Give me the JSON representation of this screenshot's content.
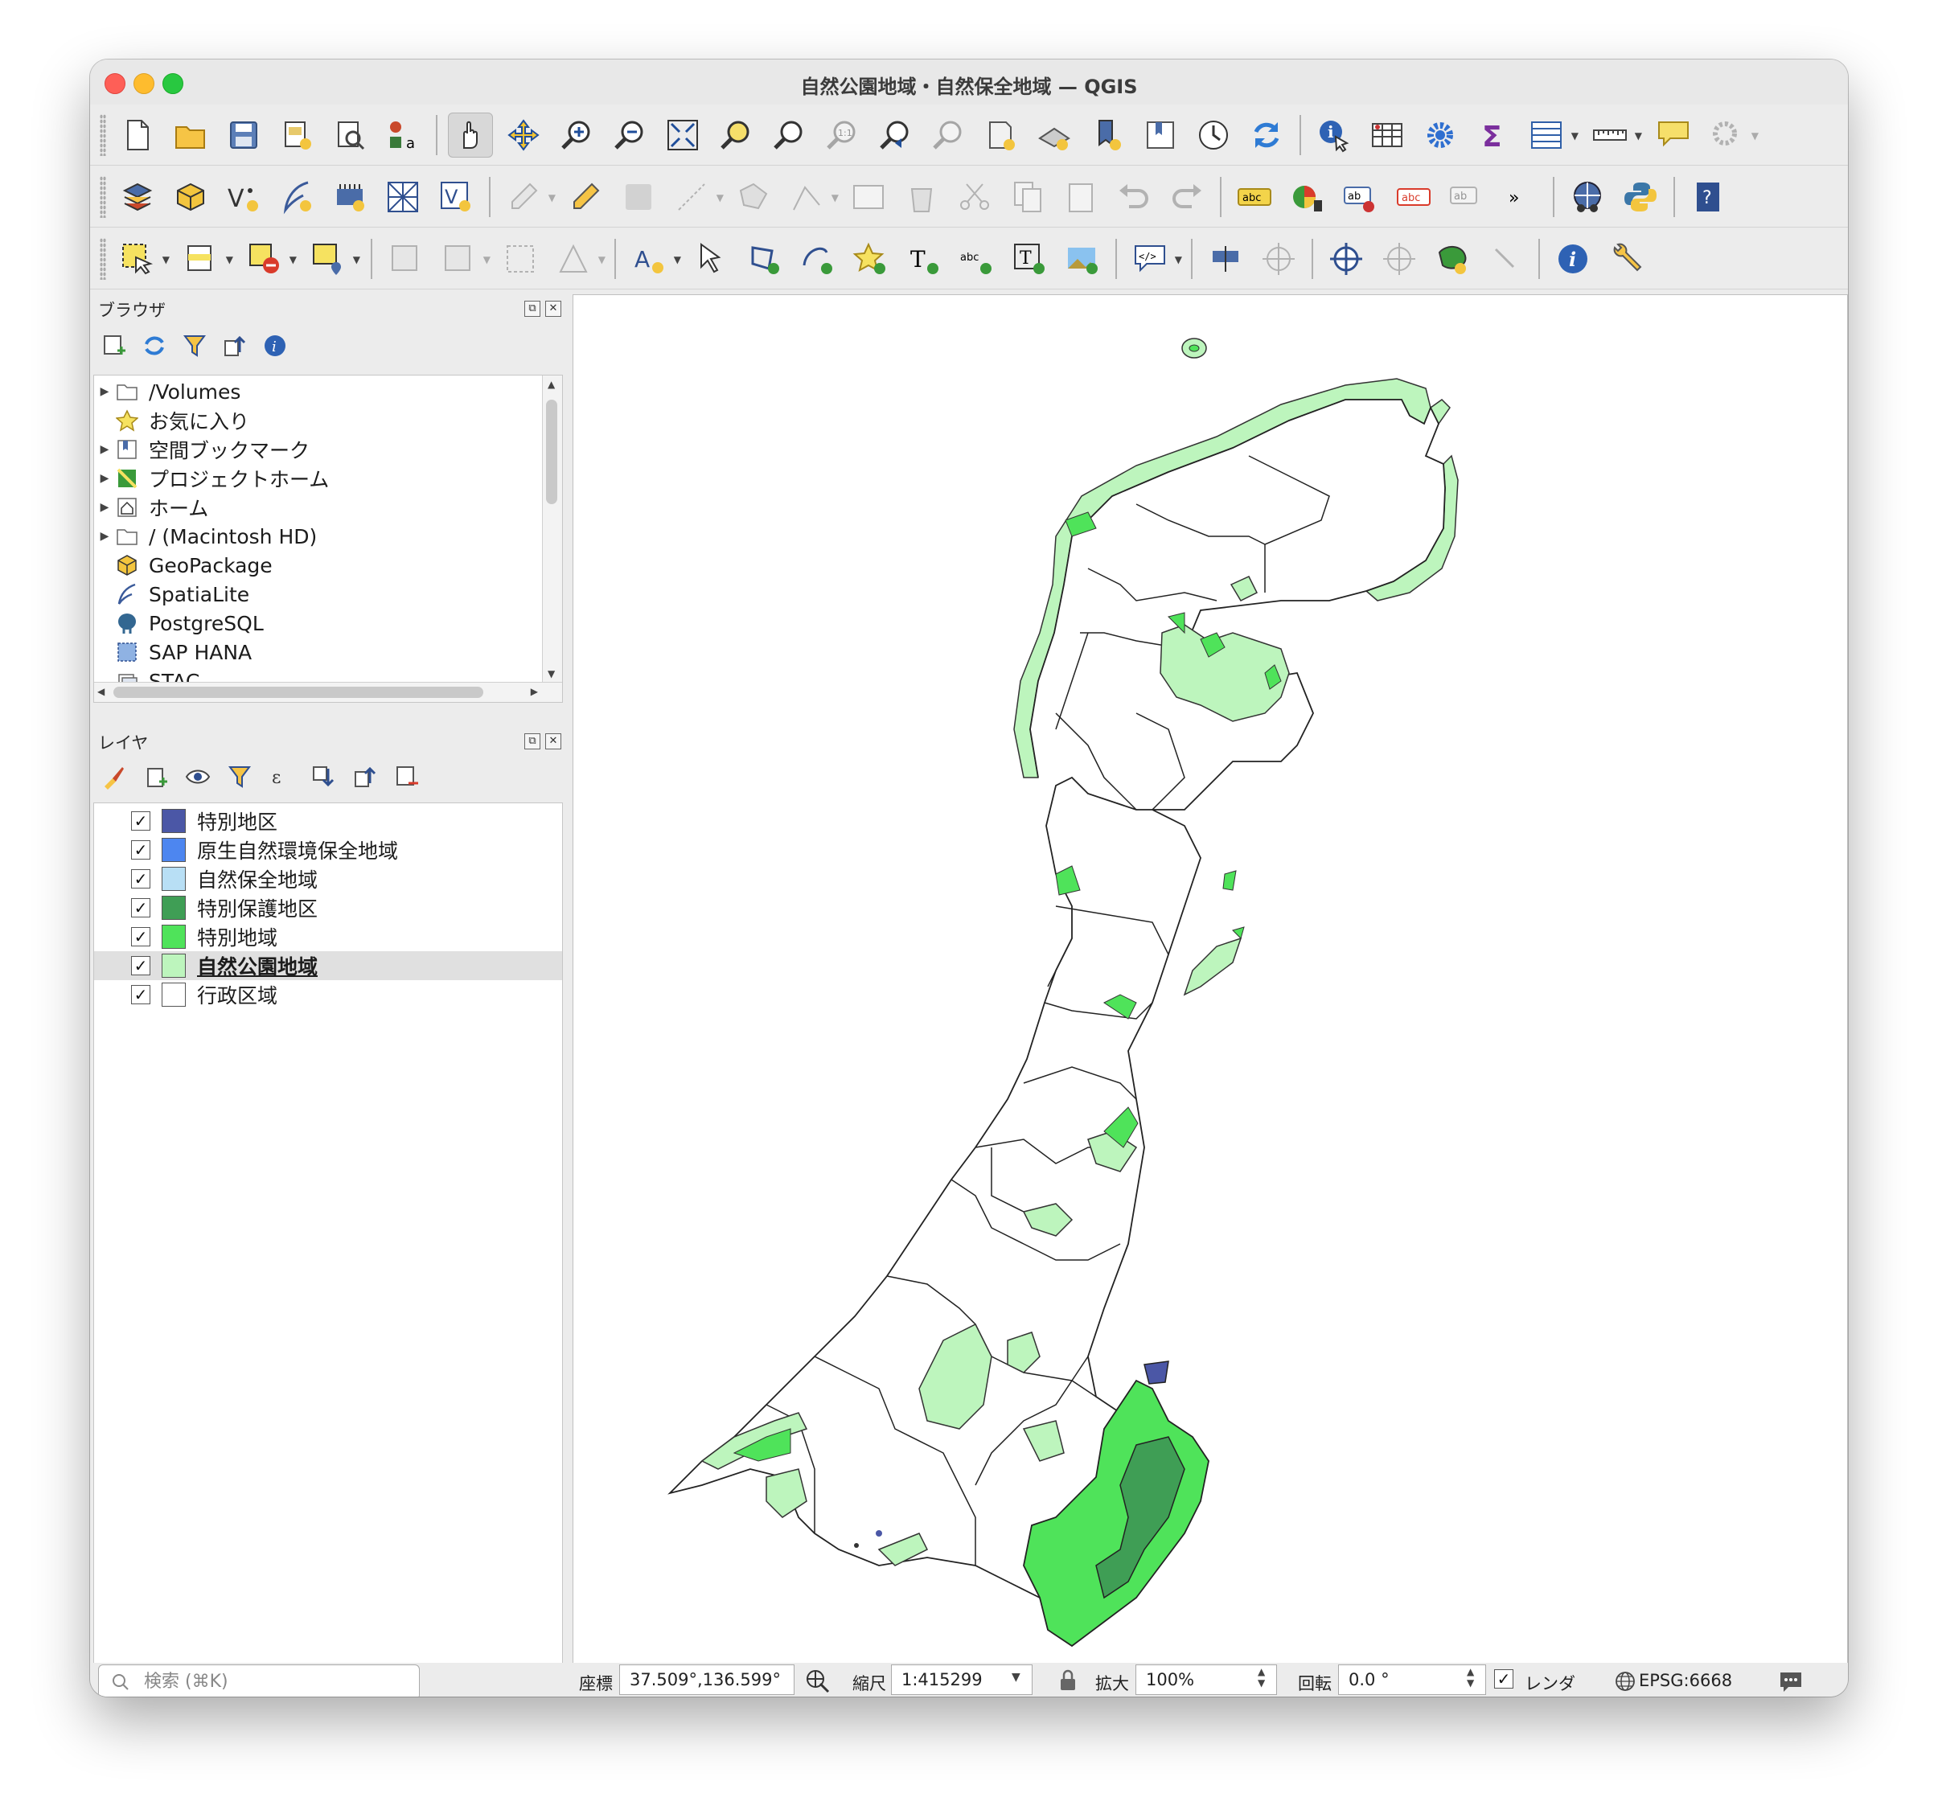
{
  "window": {
    "title": "自然公園地域・自然保全地域 — QGIS"
  },
  "toolbars": {
    "row1": [
      "new-project",
      "open-project",
      "save-project",
      "print-layout",
      "layout-manager",
      "style-manager",
      "pan-map",
      "pan-to-selection",
      "zoom-in",
      "zoom-out",
      "zoom-full",
      "zoom-to-selection",
      "zoom-to-layer",
      "zoom-native",
      "zoom-last",
      "zoom-next",
      "new-map-view",
      "new-3d-view",
      "new-bookmark",
      "show-bookmarks",
      "temporal-controller",
      "refresh",
      "identify",
      "attribute-table-open",
      "settings",
      "statistics",
      "attribute-table",
      "measure",
      "map-tips",
      "locator"
    ],
    "row2": [
      "data-source-manager",
      "new-geopackage",
      "new-shapefile",
      "new-spatialite",
      "new-virtual",
      "new-mesh",
      "new-temp-scratch",
      "toggle-editing",
      "digitize",
      "save-edits",
      "add-line",
      "add-polygon",
      "vertex-tool",
      "edit-attributes",
      "delete",
      "cut",
      "copy",
      "paste",
      "undo",
      "redo",
      "label-tool",
      "diagram-tool",
      "highlight-label",
      "label-properties",
      "pin-labels",
      "more",
      "globe",
      "python",
      "help"
    ],
    "row3": [
      "select-feature",
      "select-by-attribute",
      "deselect",
      "select-by-location",
      "digitize-shape",
      "advanced-digitize",
      "split",
      "reshape",
      "label-tool-2",
      "select-annotation",
      "add-polygon-annotation",
      "add-line-annotation",
      "add-point-annotation",
      "add-text-annotation",
      "add-point-text",
      "add-rect-text",
      "add-picture-annotation",
      "html-annotation",
      "georef",
      "coordinate",
      "crosshair",
      "geometry-checker",
      "rename",
      "info",
      "wrench"
    ]
  },
  "browser": {
    "title": "ブラウザ",
    "items": [
      {
        "label": "/Volumes",
        "icon": "folder-icon",
        "expandable": true
      },
      {
        "label": "お気に入り",
        "icon": "star-icon",
        "expandable": false
      },
      {
        "label": "空間ブックマーク",
        "icon": "bookmark-icon",
        "expandable": true
      },
      {
        "label": "プロジェクトホーム",
        "icon": "project-home-icon",
        "expandable": true
      },
      {
        "label": "ホーム",
        "icon": "home-icon",
        "expandable": true
      },
      {
        "label": "/ (Macintosh HD)",
        "icon": "folder-icon",
        "expandable": true
      },
      {
        "label": "GeoPackage",
        "icon": "geopackage-icon",
        "expandable": false
      },
      {
        "label": "SpatiaLite",
        "icon": "spatialite-icon",
        "expandable": false
      },
      {
        "label": "PostgreSQL",
        "icon": "postgresql-icon",
        "expandable": false
      },
      {
        "label": "SAP HANA",
        "icon": "sap-hana-icon",
        "expandable": false
      },
      {
        "label": "STAC",
        "icon": "stac-icon",
        "expandable": false
      }
    ]
  },
  "layers": {
    "title": "レイヤ",
    "items": [
      {
        "label": "特別地区",
        "color": "#4b57a6",
        "checked": "✓"
      },
      {
        "label": "原生自然環境保全地域",
        "color": "#4d86f0",
        "checked": "✓"
      },
      {
        "label": "自然保全地域",
        "color": "#b8dff5",
        "checked": "✓"
      },
      {
        "label": "特別保護地区",
        "color": "#3f9e55",
        "checked": "✓"
      },
      {
        "label": "特別地域",
        "color": "#4fe35a",
        "checked": "✓"
      },
      {
        "label": "自然公園地域",
        "color": "#bdf5bd",
        "checked": "✓",
        "selected": true
      },
      {
        "label": "行政区域",
        "color": "#ffffff",
        "checked": "✓"
      }
    ]
  },
  "statusbar": {
    "search_placeholder": "検索 (⌘K)",
    "coordinate_label": "座標",
    "coordinate_value": "37.509°,136.599°",
    "scale_label": "縮尺",
    "scale_value": "1:415299",
    "magnifier_label": "拡大",
    "magnifier_value": "100%",
    "rotation_label": "回転",
    "rotation_value": "0.0 °",
    "render_label": "レンダ",
    "render_checked": "✓",
    "crs": "EPSG:6668"
  }
}
